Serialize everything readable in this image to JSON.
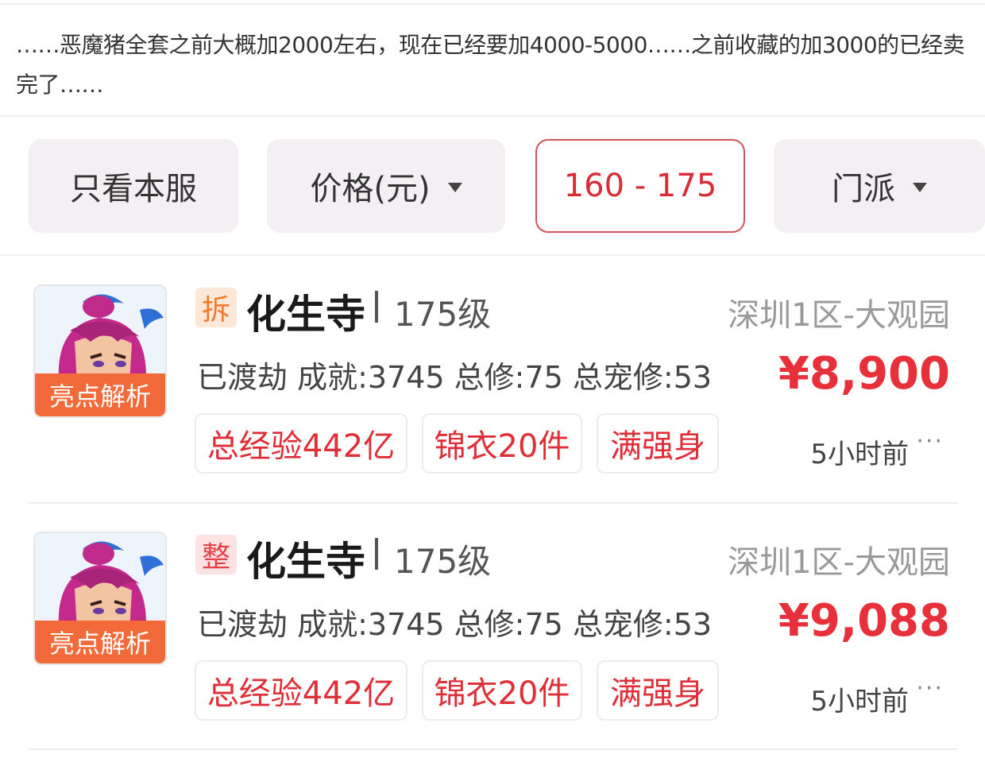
{
  "comment": {
    "text": "……恶魔猪全套之前大概加2000左右，现在已经要加4000-5000……之前收藏的加3000的已经卖完了……"
  },
  "filters": {
    "server_only": "只看本服",
    "price_label": "价格(元)",
    "level_range": "160 - 175",
    "school_label": "门派"
  },
  "listings": [
    {
      "avatar_banner": "亮点解析",
      "badge": "拆",
      "school": "化生寺",
      "level": "175级",
      "server": "深圳1区-大观园",
      "stats": "已渡劫 成就:3745 总修:75 总宠修:53",
      "price": "¥8,900",
      "tags": [
        "总经验442亿",
        "锦衣20件",
        "满强身"
      ],
      "time": "5小时前",
      "more": "···"
    },
    {
      "avatar_banner": "亮点解析",
      "badge": "整",
      "school": "化生寺",
      "level": "175级",
      "server": "深圳1区-大观园",
      "stats": "已渡劫 成就:3745 总修:75 总宠修:53",
      "price": "¥9,088",
      "tags": [
        "总经验442亿",
        "锦衣20件",
        "满强身"
      ],
      "time": "5小时前",
      "more": "···"
    }
  ],
  "colors": {
    "accent_red": "#e8303a",
    "banner_orange": "#f26a3a",
    "filter_bg": "#f4eff2"
  },
  "icons": {
    "dropdown": "caret-down-icon",
    "more": "more-dots-icon"
  }
}
